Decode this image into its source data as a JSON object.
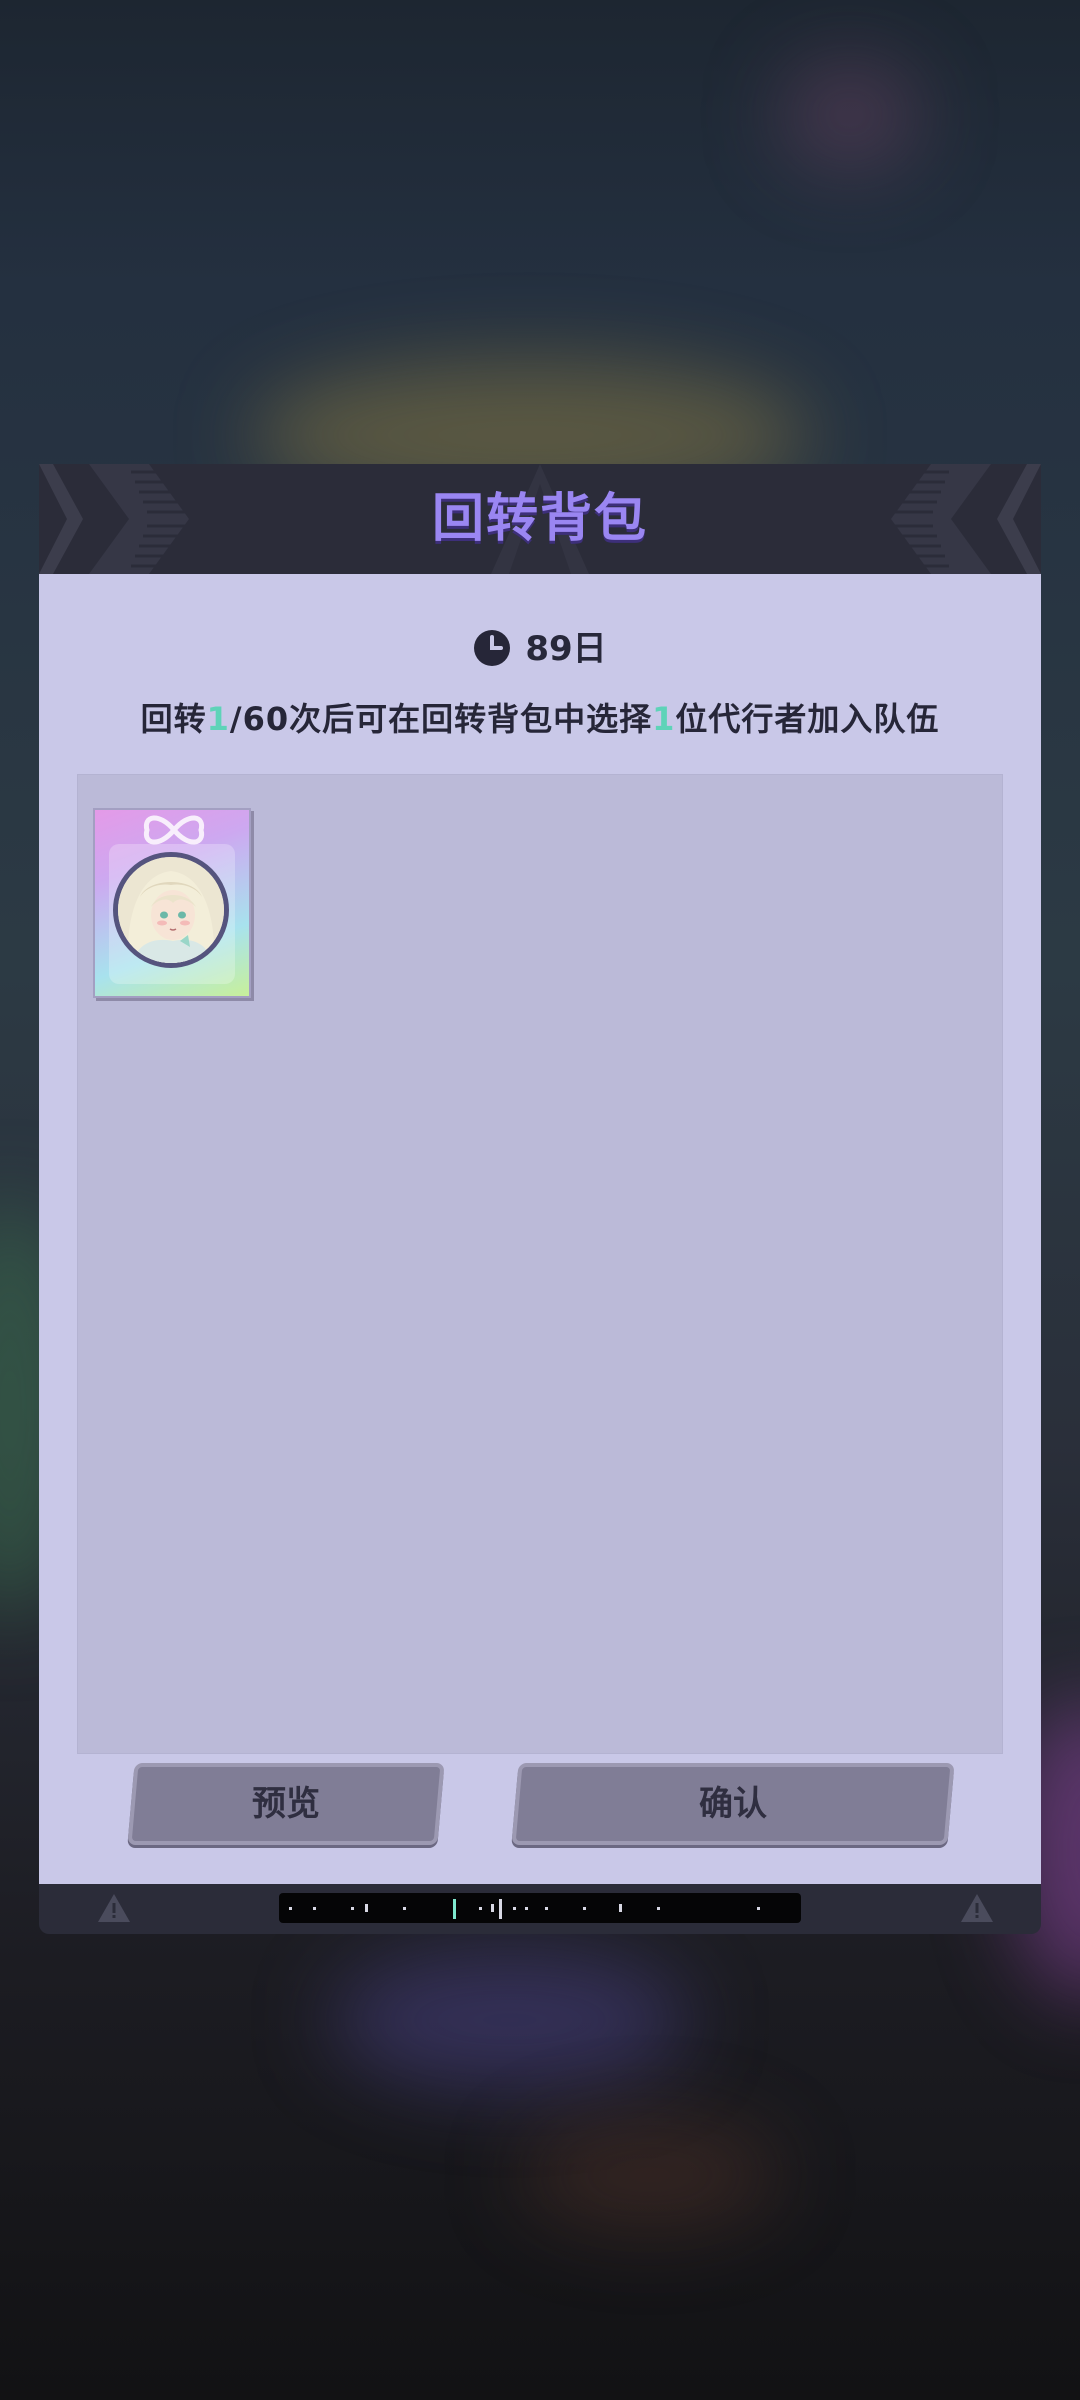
{
  "dialog": {
    "title": "回转背包",
    "timer": {
      "icon": "clock-icon",
      "text": "89日"
    },
    "description": {
      "prefix": "回转",
      "count_current": "1",
      "count_rest": "/60次后可在回转背包中选择",
      "pick_count": "1",
      "suffix": "位代行者加入队伍"
    },
    "items": [
      {
        "type": "character-card",
        "icon": "character-portrait"
      }
    ],
    "buttons": {
      "preview_label": "预览",
      "confirm_label": "确认"
    }
  },
  "colors": {
    "title": "#9a86f2",
    "highlight": "#5ed3b8",
    "panel": "#c9c8e8",
    "grid": "#bbbad8",
    "button": "#807d96",
    "header": "#2b2c39"
  }
}
